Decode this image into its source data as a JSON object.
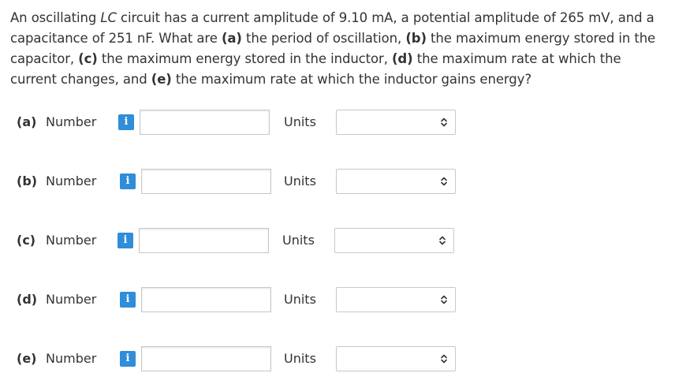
{
  "question": {
    "segments": [
      {
        "text": "An oscillating ",
        "style": "normal"
      },
      {
        "text": "LC",
        "style": "italic"
      },
      {
        "text": " circuit has a current amplitude of 9.10 mA, a potential amplitude of 265 mV, and a capacitance of 251 nF. What are ",
        "style": "normal"
      },
      {
        "text": "(a)",
        "style": "bold"
      },
      {
        "text": " the period of oscillation, ",
        "style": "normal"
      },
      {
        "text": "(b)",
        "style": "bold"
      },
      {
        "text": " the maximum energy stored in the capacitor, ",
        "style": "normal"
      },
      {
        "text": "(c)",
        "style": "bold"
      },
      {
        "text": " the maximum energy stored in the inductor, ",
        "style": "normal"
      },
      {
        "text": "(d)",
        "style": "bold"
      },
      {
        "text": " the maximum rate at which the current changes, and ",
        "style": "normal"
      },
      {
        "text": "(e)",
        "style": "bold"
      },
      {
        "text": " the maximum rate at which the inductor gains energy?",
        "style": "normal"
      }
    ]
  },
  "parts": [
    {
      "label": "(a)",
      "number_label": "Number",
      "info_icon": "i",
      "value": "",
      "units_label": "Units",
      "units_value": ""
    },
    {
      "label": "(b)",
      "number_label": "Number",
      "info_icon": "i",
      "value": "",
      "units_label": "Units",
      "units_value": ""
    },
    {
      "label": "(c)",
      "number_label": "Number",
      "info_icon": "i",
      "value": "",
      "units_label": "Units",
      "units_value": ""
    },
    {
      "label": "(d)",
      "number_label": "Number",
      "info_icon": "i",
      "value": "",
      "units_label": "Units",
      "units_value": ""
    },
    {
      "label": "(e)",
      "number_label": "Number",
      "info_icon": "i",
      "value": "",
      "units_label": "Units",
      "units_value": ""
    }
  ],
  "colors": {
    "info_icon_bg": "#2f8dd9",
    "text": "#333333",
    "input_border": "#c8c8c8"
  },
  "icons": {
    "info": "info-icon",
    "select_caret": "up-down-caret-icon"
  }
}
